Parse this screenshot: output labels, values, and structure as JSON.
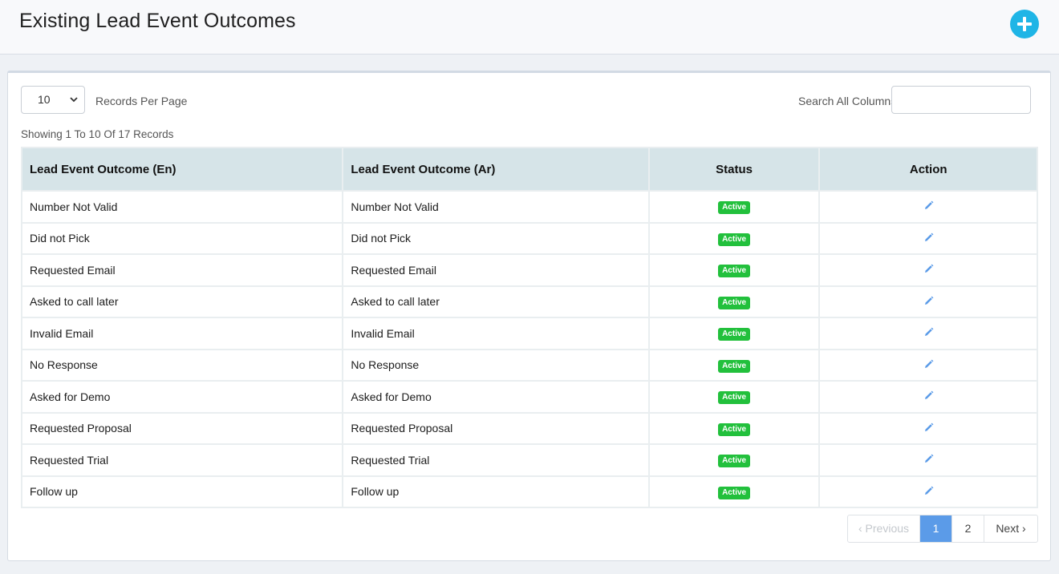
{
  "header": {
    "title": "Existing Lead Event Outcomes",
    "add_icon": "plus-circle-icon",
    "accent": "#1fb5e6"
  },
  "controls": {
    "per_page_value": "10",
    "per_page_label": "Records Per Page",
    "search_label": "Search All Columns",
    "search_value": "",
    "showing": "Showing 1 To 10 Of 17 Records"
  },
  "table": {
    "headers": [
      "Lead Event Outcome (En)",
      "Lead Event Outcome (Ar)",
      "Status",
      "Action"
    ],
    "rows": [
      {
        "en": "Number Not Valid",
        "ar": "Number Not Valid",
        "status": "Active"
      },
      {
        "en": "Did not Pick",
        "ar": "Did not Pick",
        "status": "Active"
      },
      {
        "en": "Requested Email",
        "ar": "Requested Email",
        "status": "Active"
      },
      {
        "en": "Asked to call later",
        "ar": "Asked to call later",
        "status": "Active"
      },
      {
        "en": "Invalid Email",
        "ar": "Invalid Email",
        "status": "Active"
      },
      {
        "en": "No Response",
        "ar": "No Response",
        "status": "Active"
      },
      {
        "en": "Asked for Demo",
        "ar": "Asked for Demo",
        "status": "Active"
      },
      {
        "en": "Requested Proposal",
        "ar": "Requested Proposal",
        "status": "Active"
      },
      {
        "en": "Requested Trial",
        "ar": "Requested Trial",
        "status": "Active"
      },
      {
        "en": "Follow up",
        "ar": "Follow up",
        "status": "Active"
      }
    ],
    "action_icon": "pencil-icon",
    "status_color": "#22c03c"
  },
  "pagination": {
    "previous": "Previous",
    "pages": [
      "1",
      "2"
    ],
    "current": "1",
    "next": "Next"
  }
}
